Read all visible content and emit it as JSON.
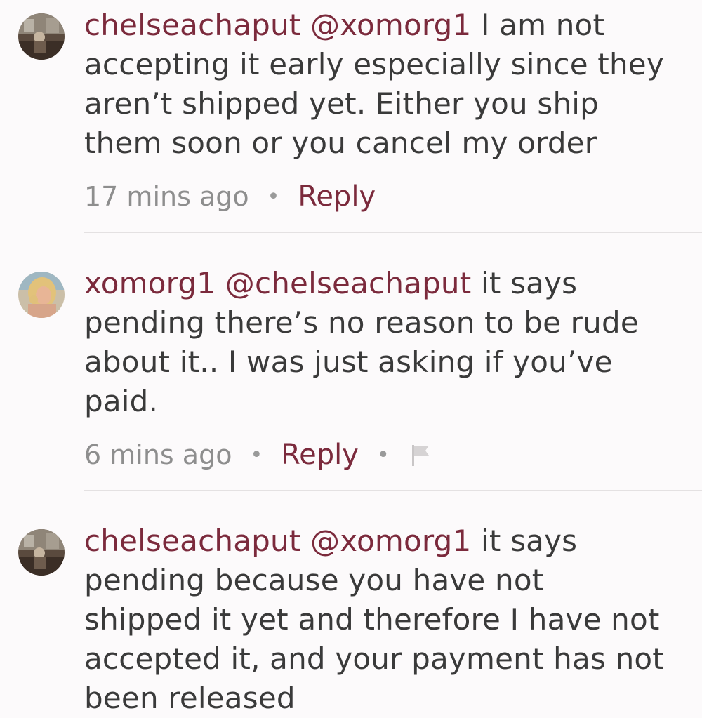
{
  "comments": [
    {
      "username": "chelseachaput",
      "mention": "@xomorg1",
      "text": "I am not\naccepting it early especially since they\naren’t shipped yet. Either you ship\nthem soon or you cancel my order",
      "first_line_text": "I am not",
      "rest_text": "accepting it early especially since they\naren’t shipped yet. Either you ship\nthem soon or you cancel my order",
      "time": "17 mins ago",
      "reply_label": "Reply",
      "separator": "•"
    },
    {
      "username": "xomorg1",
      "mention": "@chelseachaput",
      "first_line_text": "it says",
      "rest_text": "pending there’s no reason to be rude\nabout it.. I was just asking if you’ve\npaid.",
      "time": "6 mins ago",
      "reply_label": "Reply",
      "separator": "•",
      "flag_icon": "flag-icon"
    },
    {
      "username": "chelseachaput",
      "mention": "@xomorg1",
      "first_line_text": "it says",
      "rest_text": "pending because you have not\nshipped it yet and therefore I have not\naccepted it, and your payment has not\nbeen released"
    }
  ],
  "colors": {
    "accent": "#7b2a3c",
    "text": "#3a3a3a",
    "muted": "#8e8e8e",
    "divider": "#e4e1e2",
    "background": "#fcfafb"
  }
}
